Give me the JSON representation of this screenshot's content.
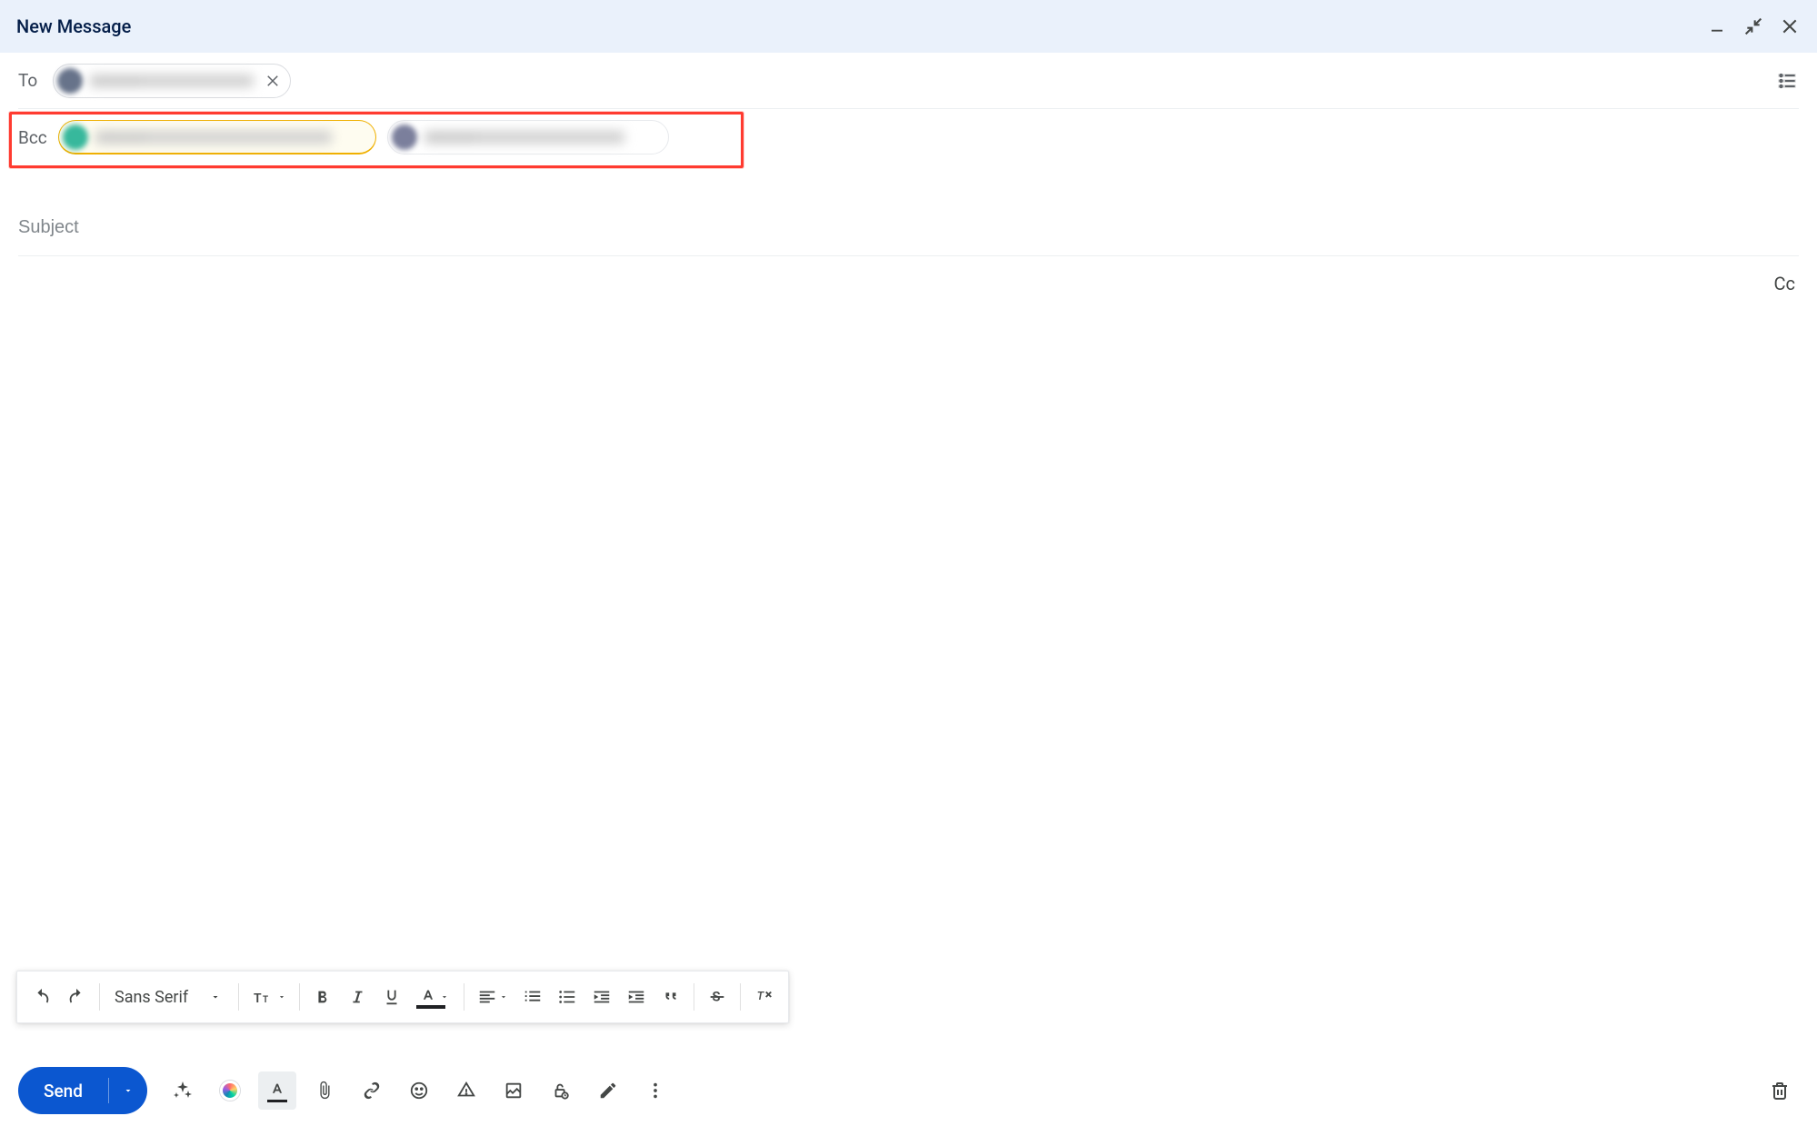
{
  "titlebar": {
    "title": "New Message"
  },
  "fields": {
    "to_label": "To",
    "bcc_label": "Bcc",
    "cc_link": "Cc",
    "subject_placeholder": "Subject",
    "to_chip_text": "redacted",
    "bcc_chip1_text": "redacted",
    "bcc_chip2_text": "redacted"
  },
  "format": {
    "font_name": "Sans Serif"
  },
  "bottombar": {
    "send_label": "Send"
  }
}
